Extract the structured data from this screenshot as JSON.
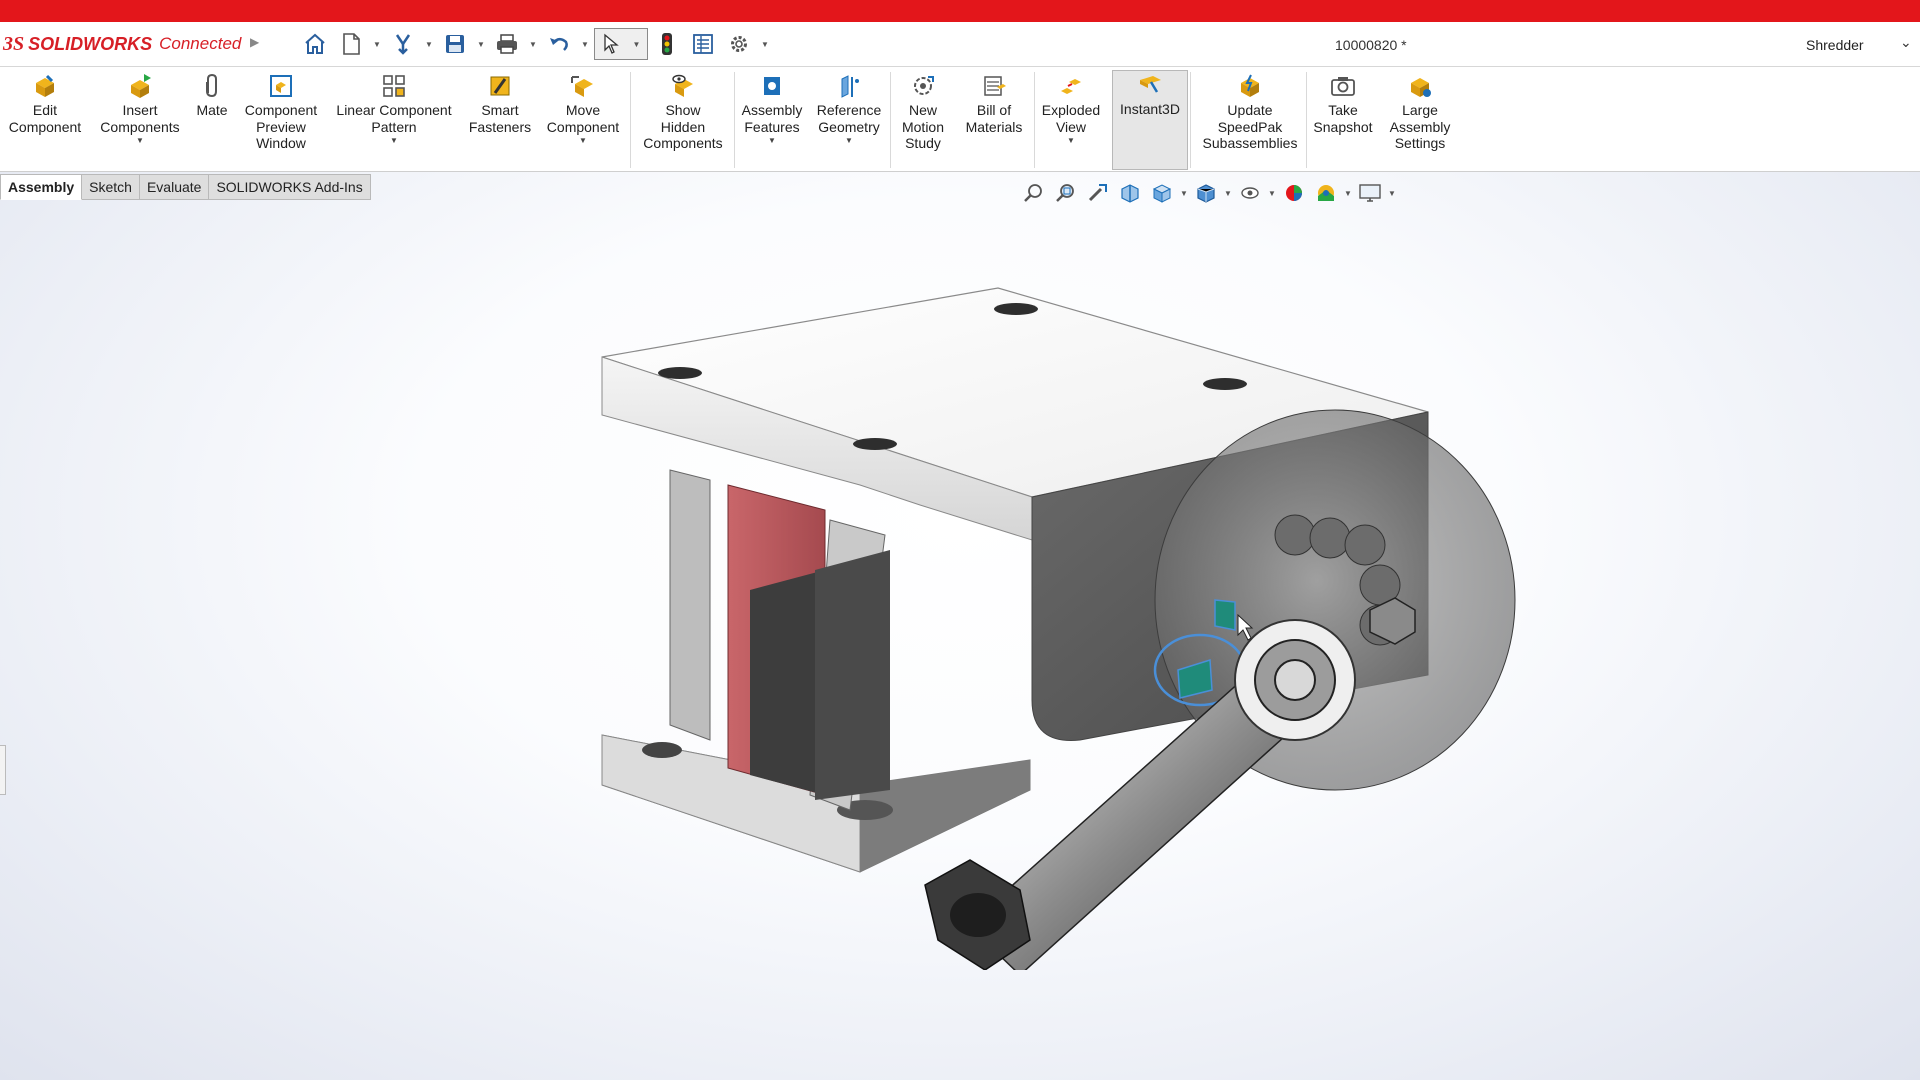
{
  "app": {
    "brand_ds": "3S",
    "brand": "SOLIDWORKS",
    "suffix": "Connected",
    "document_title": "10000820 *",
    "user": "Shredder"
  },
  "colors": {
    "accent_red": "#e3161b",
    "brand_red": "#d71f26",
    "icon_blue": "#1d6fb8",
    "icon_yellow": "#f0b41c"
  },
  "quick_access": [
    {
      "icon": "home-icon"
    },
    {
      "icon": "new-document-icon"
    },
    {
      "icon": "open-icon"
    },
    {
      "icon": "save-icon"
    },
    {
      "icon": "print-icon"
    },
    {
      "icon": "undo-icon"
    },
    {
      "icon": "select-pointer-icon"
    },
    {
      "icon": "rebuild-traffic-light-icon"
    },
    {
      "icon": "file-properties-icon"
    },
    {
      "icon": "options-gear-icon"
    }
  ],
  "ribbon": {
    "edit_component": "Edit\nComponent",
    "insert_components": "Insert\nComponents",
    "mate": "Mate",
    "component_preview": "Component\nPreview\nWindow",
    "linear_pattern": "Linear Component\nPattern",
    "smart_fasteners": "Smart\nFasteners",
    "move_component": "Move\nComponent",
    "show_hidden": "Show\nHidden\nComponents",
    "assembly_features": "Assembly\nFeatures",
    "reference_geometry": "Reference\nGeometry",
    "new_motion_study": "New\nMotion\nStudy",
    "bill_of_materials": "Bill of\nMaterials",
    "exploded_view": "Exploded\nView",
    "instant3d": "Instant3D",
    "update_speedpak": "Update\nSpeedPak\nSubassemblies",
    "take_snapshot": "Take\nSnapshot",
    "large_assembly": "Large\nAssembly\nSettings"
  },
  "tabs": [
    "Assembly",
    "Sketch",
    "Evaluate",
    "SOLIDWORKS Add-Ins"
  ],
  "active_tab": "Assembly",
  "hud_icons": [
    "zoom-to-fit-icon",
    "zoom-to-area-icon",
    "previous-view-icon",
    "section-view-icon",
    "view-orientation-icon",
    "display-style-icon",
    "hide-show-items-icon",
    "edit-appearance-icon",
    "apply-scene-icon",
    "view-settings-icon"
  ],
  "instant3d_active": true
}
